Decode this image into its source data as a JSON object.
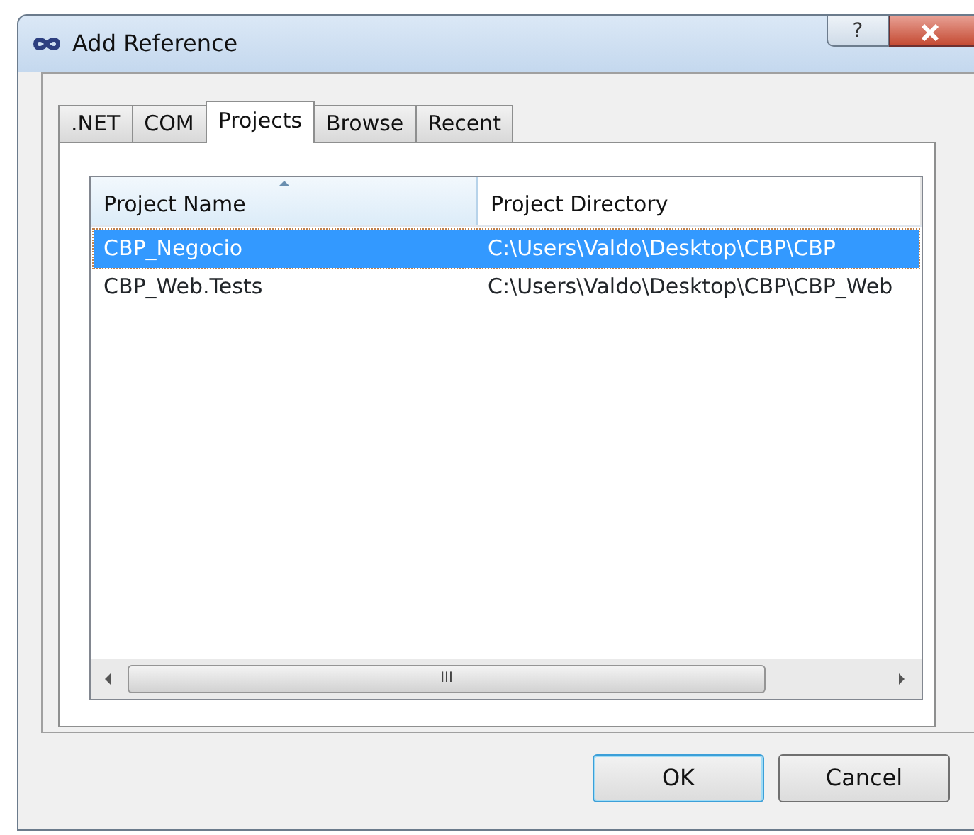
{
  "window": {
    "title": "Add Reference",
    "help_label": "?"
  },
  "tabs": [
    {
      "label": ".NET",
      "selected": false
    },
    {
      "label": "COM",
      "selected": false
    },
    {
      "label": "Projects",
      "selected": true
    },
    {
      "label": "Browse",
      "selected": false
    },
    {
      "label": "Recent",
      "selected": false
    }
  ],
  "table": {
    "columns": [
      {
        "label": "Project Name",
        "sorted": true
      },
      {
        "label": "Project Directory",
        "sorted": false
      }
    ],
    "rows": [
      {
        "cells": [
          "CBP_Negocio",
          "C:\\Users\\Valdo\\Desktop\\CBP\\CBP"
        ],
        "selected": true
      },
      {
        "cells": [
          "CBP_Web.Tests",
          "C:\\Users\\Valdo\\Desktop\\CBP\\CBP_Web"
        ],
        "selected": false
      }
    ],
    "scrollbar_grip": "III"
  },
  "buttons": [
    {
      "label": "OK",
      "default": true
    },
    {
      "label": "Cancel",
      "default": false
    }
  ]
}
